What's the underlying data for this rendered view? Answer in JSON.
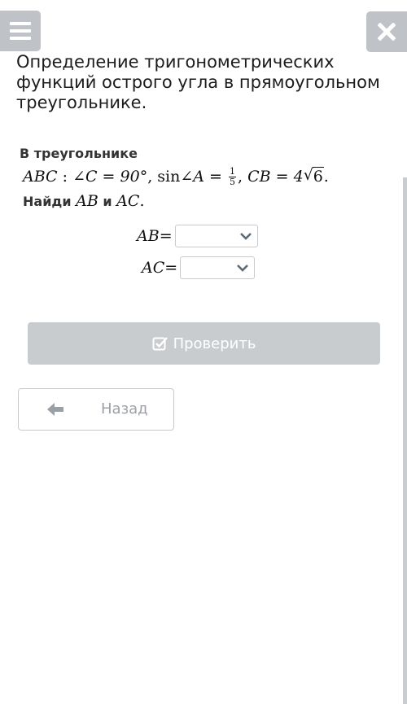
{
  "header": {
    "menu_icon": "hamburger-menu-icon",
    "close_icon": "close-x-icon"
  },
  "title": "Определение тригонометрических функций острого угла в прямоугольном треугольнике.",
  "problem": {
    "intro": "В треугольнике",
    "triangle": "ABC",
    "colon": " : ",
    "angle_c": "∠C = 90°",
    "comma1": ", ",
    "sin_fn": "sin",
    "sin_angle": "∠A = ",
    "frac_num": "1",
    "frac_den": "5",
    "comma2": ", ",
    "cb_label": "CB = 4",
    "sqrt_value": "6",
    "period": ".",
    "task_prefix": "Найди",
    "task_ab": "AB",
    "task_and": "и",
    "task_ac": "AC",
    "task_period": "."
  },
  "answers": [
    {
      "label": "AB",
      "equals": "=",
      "value": ""
    },
    {
      "label": "AC",
      "equals": "=",
      "value": ""
    }
  ],
  "buttons": {
    "check_label": "Проверить",
    "back_label": "Назад"
  },
  "colors": {
    "disabled_button": "#c9cccf",
    "header_button": "#bfc3c7",
    "back_text": "#9aa0a6"
  }
}
